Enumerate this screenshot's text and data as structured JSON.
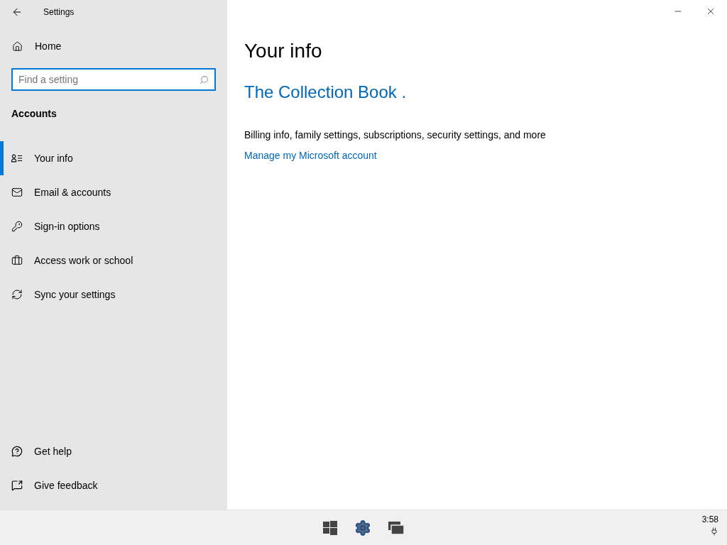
{
  "window": {
    "title": "Settings"
  },
  "sidebar": {
    "home": "Home",
    "search": {
      "placeholder": "Find a setting"
    },
    "section": "Accounts",
    "items": [
      {
        "label": "Your info",
        "selected": true
      },
      {
        "label": "Email & accounts",
        "selected": false
      },
      {
        "label": "Sign-in options",
        "selected": false
      },
      {
        "label": "Access work or school",
        "selected": false
      },
      {
        "label": "Sync your settings",
        "selected": false
      }
    ],
    "footer": [
      "Get help",
      "Give feedback"
    ]
  },
  "content": {
    "title": "Your info",
    "account_name": "The Collection Book .",
    "description": "Billing info, family settings, subscriptions, security settings, and more",
    "link": "Manage my Microsoft account"
  },
  "taskbar": {
    "clock": "3:58"
  }
}
